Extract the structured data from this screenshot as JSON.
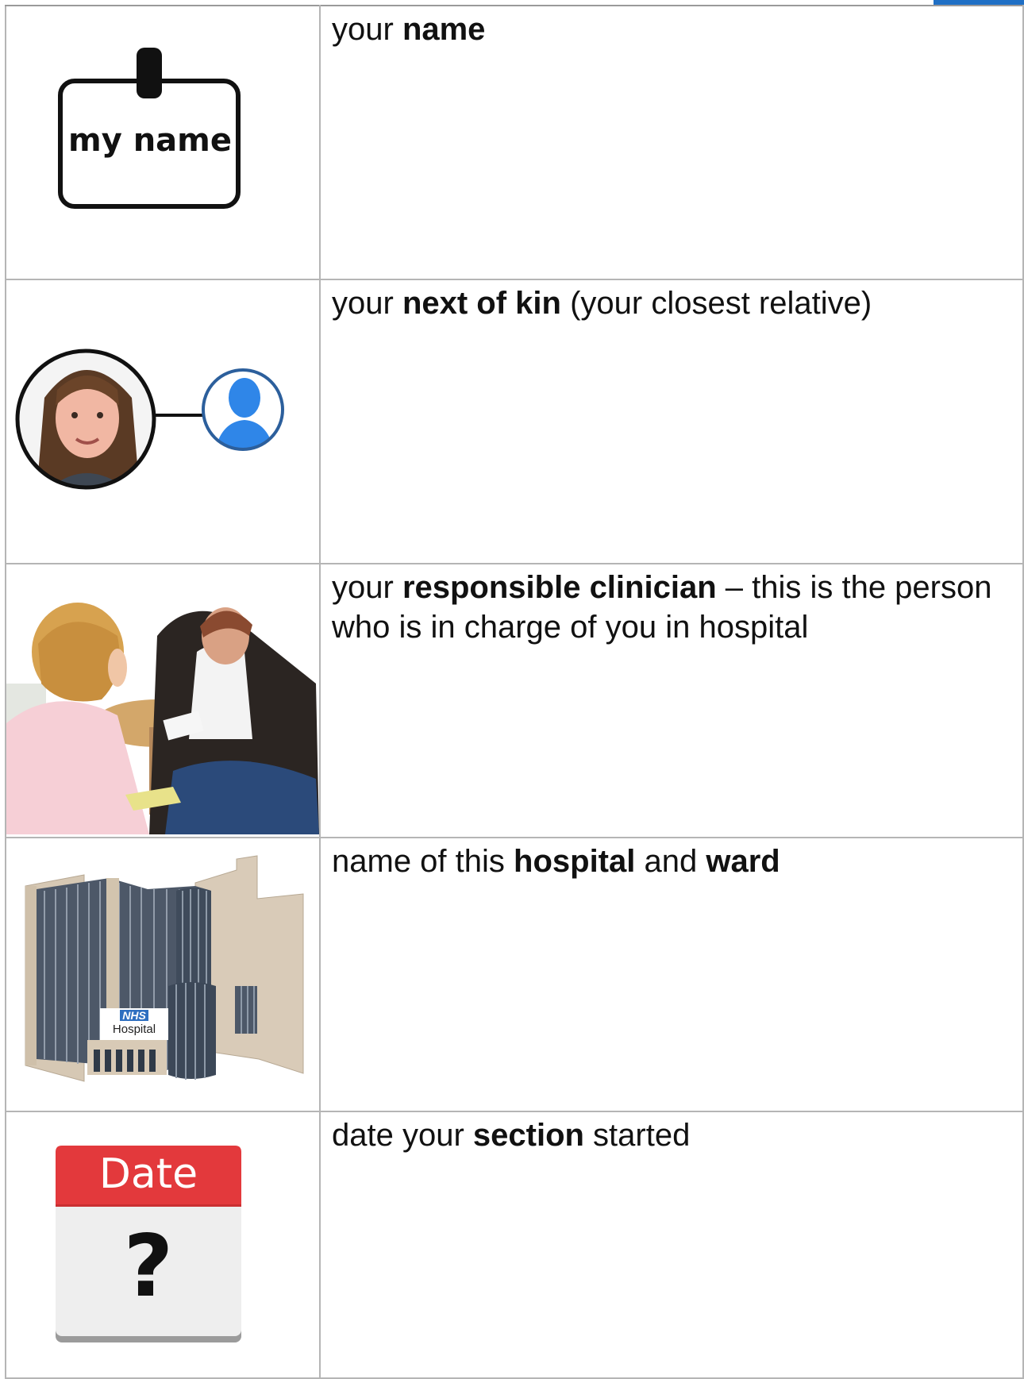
{
  "rows": [
    {
      "icon": "name-badge-icon",
      "badge_text": "my name",
      "segments": [
        {
          "text": "your ",
          "bold": false
        },
        {
          "text": "name",
          "bold": true
        }
      ]
    },
    {
      "icon": "next-of-kin-icon",
      "segments": [
        {
          "text": "your ",
          "bold": false
        },
        {
          "text": "next of kin",
          "bold": true
        },
        {
          "text": " (your closest relative)",
          "bold": false
        }
      ]
    },
    {
      "icon": "clinician-meeting-photo",
      "segments": [
        {
          "text": "your ",
          "bold": false
        },
        {
          "text": "responsible clinician",
          "bold": true
        },
        {
          "text": " – this is the person who is in charge of you in hospital",
          "bold": false
        }
      ]
    },
    {
      "icon": "hospital-building-icon",
      "sign_logo": "NHS",
      "sign_text": "Hospital",
      "segments": [
        {
          "text": "name of this ",
          "bold": false
        },
        {
          "text": "hospital",
          "bold": true
        },
        {
          "text": " and ",
          "bold": false
        },
        {
          "text": "ward",
          "bold": true
        }
      ]
    },
    {
      "icon": "calendar-date-icon",
      "calendar_header": "Date",
      "calendar_mark": "?",
      "segments": [
        {
          "text": "date your ",
          "bold": false
        },
        {
          "text": "section",
          "bold": true
        },
        {
          "text": " started",
          "bold": false
        }
      ]
    }
  ],
  "colors": {
    "tab_blue": "#1f6fc5",
    "calendar_red": "#e3393c",
    "avatar_blue": "#2f86e8"
  }
}
